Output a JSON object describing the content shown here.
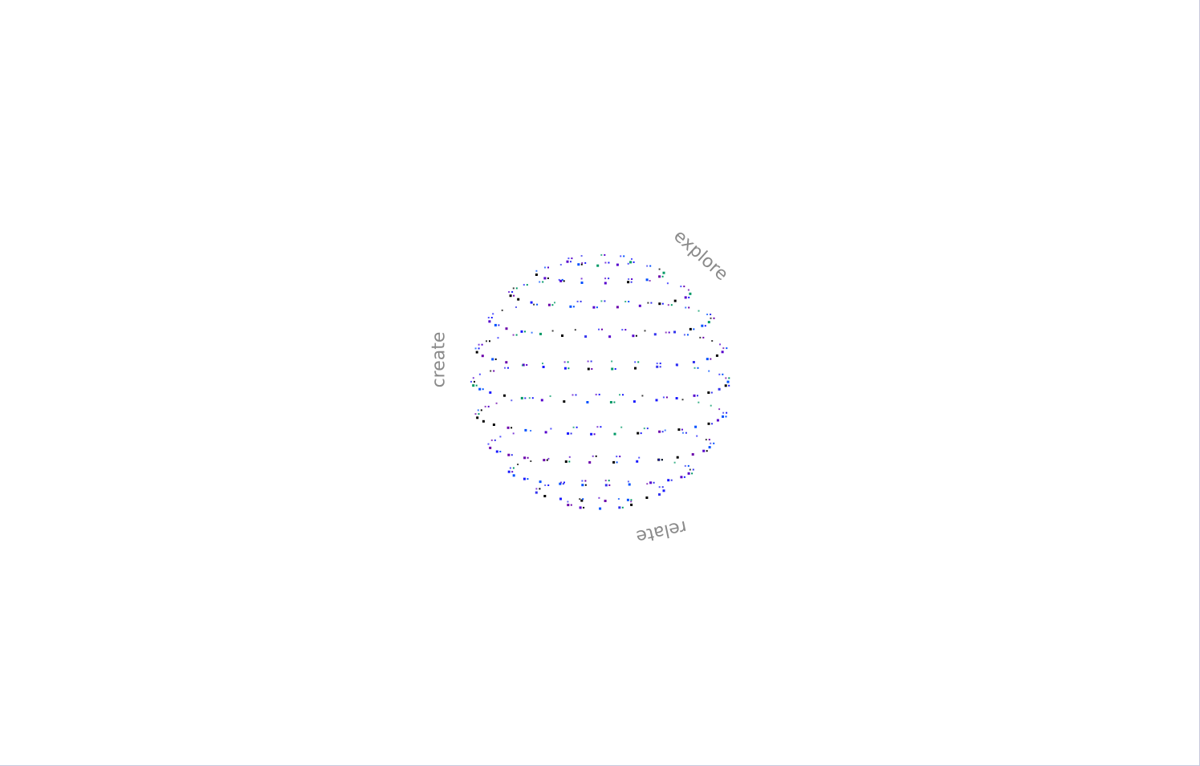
{
  "labels": {
    "explore": "explore",
    "create": "create",
    "relate": "relate"
  },
  "sphere": {
    "dot_colors": [
      "#1a1aff",
      "#5500cc",
      "#000000",
      "#009966",
      "#3333ee",
      "#6a00aa",
      "#0050ff"
    ]
  }
}
